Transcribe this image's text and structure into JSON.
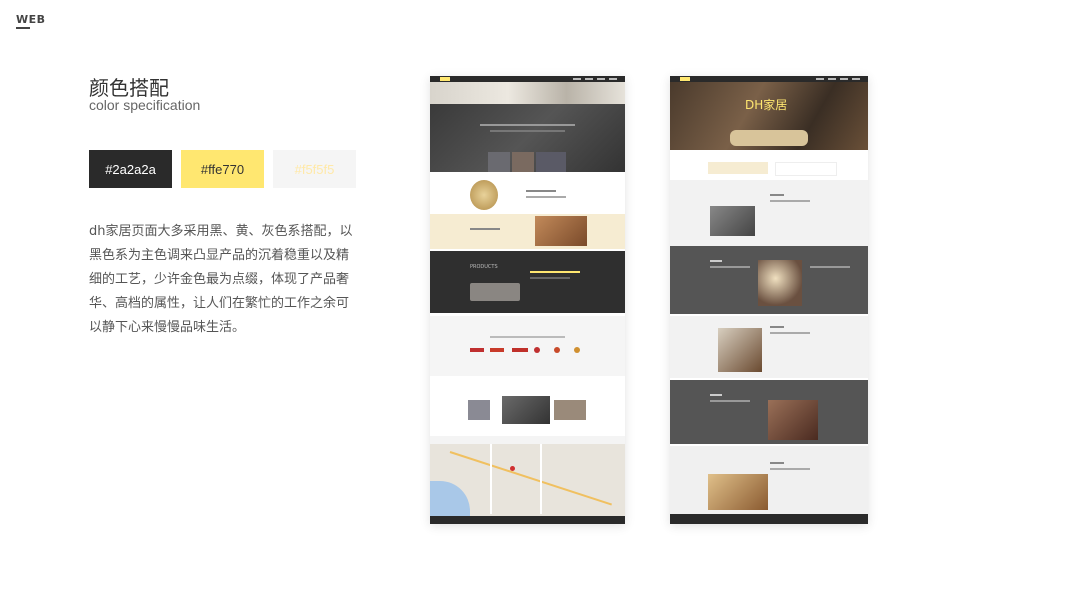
{
  "header": {
    "label": "WEB"
  },
  "section": {
    "title": "颜色搭配",
    "subtitle": "color specification"
  },
  "swatches": [
    {
      "hex": "#2a2a2a",
      "label": "#2a2a2a",
      "text_color": "#ffffff"
    },
    {
      "hex": "#ffe770",
      "label": "#ffe770",
      "text_color": "#333333"
    },
    {
      "hex": "#f5f5f5",
      "label": "#f5f5f5",
      "text_color": "#ffe9a8"
    }
  ],
  "description": "dh家居页面大多采用黑、黄、灰色系搭配，以黑色系为主色调来凸显产品的沉着稳重以及精细的工艺，少许金色最为点缀，体现了产品奢华、高档的属性，让人们在繁忙的工作之余可以静下心来慢慢品味生活。",
  "screenshot_left": {
    "hero_heading": "",
    "products_heading": "PRODUCTS",
    "partners_heading": "",
    "cases_heading": ""
  },
  "screenshot_right": {
    "hero_title": "DH家居",
    "hero_subtitle": ""
  },
  "colors": {
    "dark": "#2a2a2a",
    "accent": "#ffe770",
    "light": "#f5f5f5",
    "beige": "#f6ecd2"
  }
}
